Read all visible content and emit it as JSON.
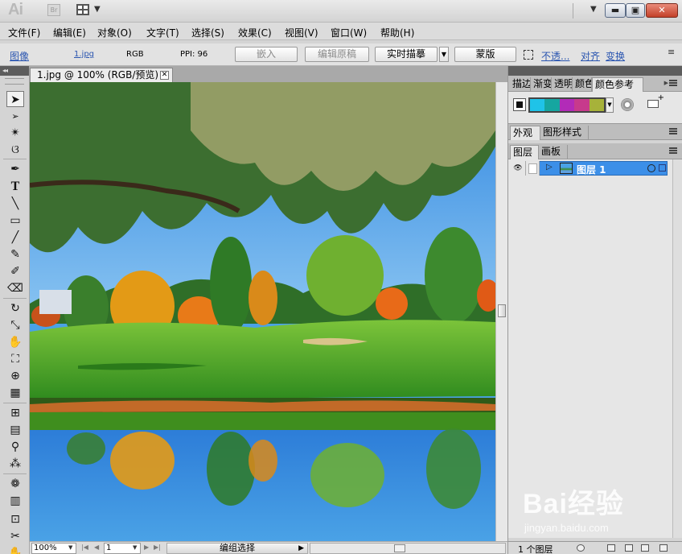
{
  "titlebar": {
    "app_logo": "Ai",
    "bridge_label": "Br"
  },
  "menus": [
    "文件(F)",
    "编辑(E)",
    "对象(O)",
    "文字(T)",
    "选择(S)",
    "效果(C)",
    "视图(V)",
    "窗口(W)",
    "帮助(H)"
  ],
  "control": {
    "object_type": "图像",
    "file_name": "1.jpg",
    "color_mode": "RGB",
    "ppi": "PPI: 96",
    "embed_btn": "嵌入",
    "edit_original_btn": "编辑原稿",
    "live_trace_btn": "实时描摹",
    "mask_btn": "蒙版",
    "opacity_link": "不透...",
    "align_link": "对齐",
    "transform_link": "变换"
  },
  "document": {
    "tab_title": "1.jpg @ 100% (RGB/预览)",
    "close_glyph": "✕"
  },
  "statusbar": {
    "zoom": "100%",
    "artboard": "1",
    "status_text": "编组选择"
  },
  "panels": {
    "guide_tabs": [
      "描边",
      "渐变",
      "透明",
      "颜色",
      "颜色参考"
    ],
    "appearance_tabs": [
      "外观",
      "图形样式"
    ],
    "layers_tabs": [
      "图层",
      "画板"
    ],
    "layer_name": "图层 1",
    "layer_count": "1 个图层"
  },
  "harmony_colors": [
    "#1fc3e8",
    "#16a6a0",
    "#b22bb8",
    "#c73a8c",
    "#a7b23a"
  ],
  "watermark": {
    "text": "Bai经验",
    "url": "jingyan.baidu.com"
  },
  "tools": [
    "选择工具",
    "直接选择工具",
    "魔棒工具",
    "套索工具",
    "钢笔工具",
    "文字工具",
    "直线段工具",
    "矩形工具",
    "画笔工具",
    "铅笔工具",
    "斑点画笔工具",
    "橡皮擦工具",
    "旋转工具",
    "比例缩放工具",
    "变形工具",
    "自由变换工具",
    "形状生成器工具",
    "透视网格工具",
    "网格工具",
    "渐变工具",
    "吸管工具",
    "混合工具",
    "符号喷枪工具",
    "柱形图工具",
    "画板工具",
    "切片工具",
    "抓手工具"
  ]
}
